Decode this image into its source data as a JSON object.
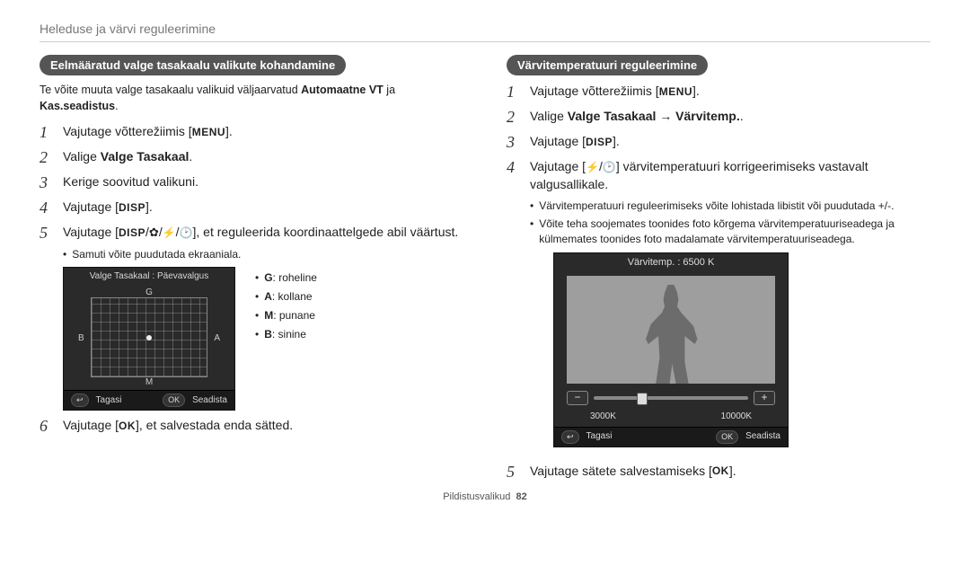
{
  "header": {
    "title": "Heleduse ja värvi reguleerimine"
  },
  "left": {
    "pill": "Eelmääratud valge tasakaalu valikute kohandamine",
    "intro_a": "Te võite muuta valge tasakaalu valikuid väljaarvatud ",
    "intro_b_bold": "Automaatne VT",
    "intro_c": " ja ",
    "intro_d_bold": "Kas.seadistus",
    "intro_e": ".",
    "steps": {
      "s1a": "Vajutage võtterežiimis [",
      "s1b": "].",
      "s2a": "Valige ",
      "s2b_bold": "Valge Tasakaal",
      "s2c": ".",
      "s3": "Kerige soovitud valikuni.",
      "s4a": "Vajutage [",
      "s4b": "].",
      "s5a": "Vajutage [",
      "s5b": "], et reguleerida koordinaattelgede abil väärtust.",
      "s5sub": "Samuti võite puudutada ekraaniala.",
      "s6a": "Vajutage [",
      "s6b": "], et salvestada enda sätted."
    },
    "preview": {
      "title": "Valge Tasakaal : Päevavalgus",
      "G": "G",
      "M": "M",
      "A": "A",
      "B": "B",
      "back": "Tagasi",
      "set": "Seadista"
    },
    "legend": {
      "g": "G: roheline",
      "a": "A: kollane",
      "m": "M: punane",
      "b": "B: sinine"
    }
  },
  "right": {
    "pill": "Värvitemperatuuri reguleerimine",
    "steps": {
      "s1a": "Vajutage võtterežiimis [",
      "s1b": "].",
      "s2a": "Valige ",
      "s2b_bold": "Valge Tasakaal",
      "s2c": " → ",
      "s2d_bold": "Värvitemp.",
      "s2e": ".",
      "s3a": "Vajutage [",
      "s3b": "].",
      "s4a": "Vajutage [",
      "s4b": "] värvitemperatuuri korrigeerimiseks vastavalt valgusallikale.",
      "s4sub1": "Värvitemperatuuri reguleerimiseks võite lohistada libistit või puudutada +/-.",
      "s4sub2": "Võite teha soojemates toonides foto kõrgema värvitemperatuuriseadega ja külmemates toonides foto madalamate värvitemperatuuriseadega.",
      "s5a": "Vajutage sätete salvestamiseks [",
      "s5b": "]."
    },
    "preview": {
      "title": "Värvitemp. : 6500 K",
      "min": "3000K",
      "max": "10000K",
      "back": "Tagasi",
      "set": "Seadista"
    }
  },
  "glyphs": {
    "menu": "MENU",
    "disp": "DISP",
    "ok": "OK",
    "back": "↩"
  },
  "footer": {
    "label": "Pildistusvalikud",
    "page": "82"
  }
}
